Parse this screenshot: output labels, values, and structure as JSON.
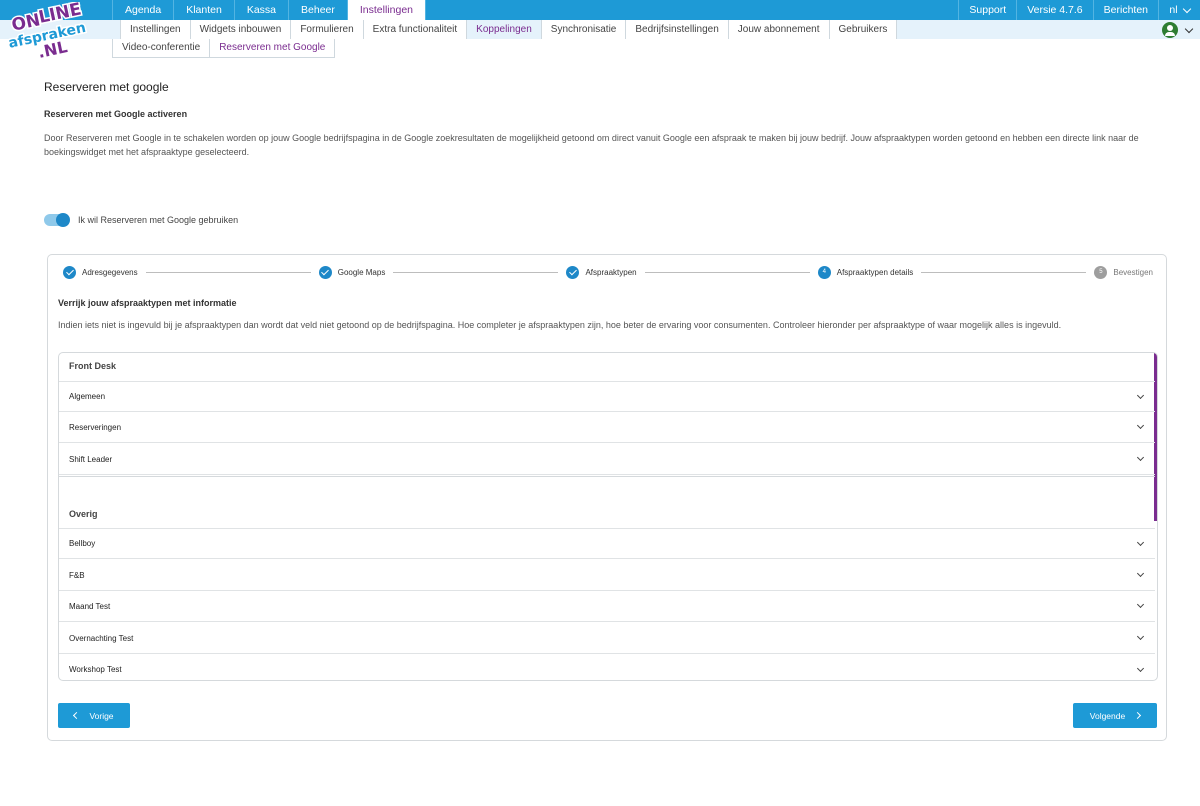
{
  "top_nav": {
    "items": [
      {
        "label": "Agenda",
        "active": false
      },
      {
        "label": "Klanten",
        "active": false
      },
      {
        "label": "Kassa",
        "active": false
      },
      {
        "label": "Beheer",
        "active": false
      },
      {
        "label": "Instellingen",
        "active": true
      }
    ],
    "right": {
      "support": "Support",
      "version": "Versie 4.7.6",
      "messages": "Berichten",
      "language": "nl"
    }
  },
  "sub_nav": {
    "items": [
      {
        "label": "Instellingen",
        "active": false
      },
      {
        "label": "Widgets inbouwen",
        "active": false
      },
      {
        "label": "Formulieren",
        "active": false
      },
      {
        "label": "Extra functionaliteit",
        "active": false
      },
      {
        "label": "Koppelingen",
        "active": true
      },
      {
        "label": "Synchronisatie",
        "active": false
      },
      {
        "label": "Bedrijfsinstellingen",
        "active": false
      },
      {
        "label": "Jouw abonnement",
        "active": false
      },
      {
        "label": "Gebruikers",
        "active": false
      }
    ]
  },
  "third_nav": {
    "items": [
      {
        "label": "Video-conferentie",
        "active": false
      },
      {
        "label": "Reserveren met Google",
        "active": true
      }
    ]
  },
  "logo": {
    "text": "ONLINE afspraken .NL"
  },
  "page": {
    "title": "Reserveren met google",
    "section_title": "Reserveren met Google activeren",
    "description": "Door Reserveren met Google in te schakelen worden op jouw Google bedrijfspagina in de Google zoekresultaten de mogelijkheid getoond om direct vanuit Google een afspraak te maken bij jouw bedrijf. Jouw afspraaktypen worden getoond en hebben een directe link naar de boekingswidget met het afspraaktype geselecteerd.",
    "toggle_label": "Ik wil Reserveren met Google gebruiken",
    "toggle_on": true
  },
  "wizard": {
    "steps": [
      {
        "label": "Adresgegevens",
        "status": "done",
        "number": "1"
      },
      {
        "label": "Google Maps",
        "status": "done",
        "number": "2"
      },
      {
        "label": "Afspraaktypen",
        "status": "done",
        "number": "3"
      },
      {
        "label": "Afspraaktypen details",
        "status": "current",
        "number": "4"
      },
      {
        "label": "Bevestigen",
        "status": "todo",
        "number": "5"
      }
    ],
    "title": "Verrijk jouw afspraaktypen met informatie",
    "description": "Indien iets niet is ingevuld bij je afspraaktypen dan wordt dat veld niet getoond op de bedrijfspagina. Hoe completer je afspraaktypen zijn, hoe beter de ervaring voor consumenten. Controleer hieronder per afspraaktype of waar mogelijk alles is ingevuld.",
    "groups": [
      {
        "name": "Front Desk",
        "items": [
          "Algemeen",
          "Reserveringen",
          "Shift Leader"
        ]
      },
      {
        "name": "Overig",
        "items": [
          "Bellboy",
          "F&B",
          "Maand Test",
          "Overnachting Test",
          "Workshop Test"
        ]
      }
    ],
    "prev_label": "Vorige",
    "next_label": "Volgende"
  },
  "colors": {
    "primary": "#1e9ad6",
    "accent": "#7a2c8f",
    "subnav_bg": "#e5f2fb",
    "avatar": "#2e7d32"
  }
}
